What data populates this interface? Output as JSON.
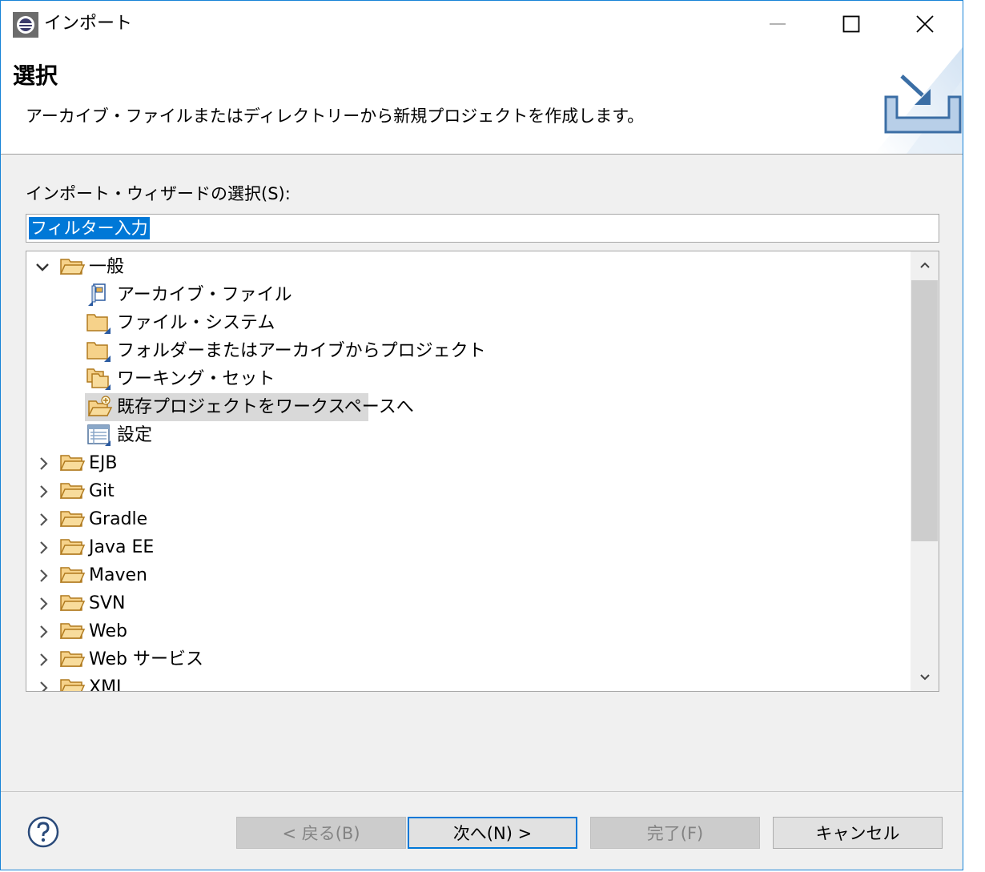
{
  "window": {
    "title": "インポート"
  },
  "banner": {
    "title": "選択",
    "description": "アーカイブ・ファイルまたはディレクトリーから新規プロジェクトを作成します。"
  },
  "wizard": {
    "label": "インポート・ウィザードの選択(S):",
    "filter_value": "フィルター入力"
  },
  "tree": {
    "items": [
      {
        "label": "一般",
        "expanded": true,
        "level": 0
      },
      {
        "label": "アーカイブ・ファイル",
        "level": 1,
        "icon": "archive-file-icon"
      },
      {
        "label": "ファイル・システム",
        "level": 1,
        "icon": "folder-icon"
      },
      {
        "label": "フォルダーまたはアーカイブからプロジェクト",
        "level": 1,
        "icon": "folder-icon"
      },
      {
        "label": "ワーキング・セット",
        "level": 1,
        "icon": "working-set-icon"
      },
      {
        "label": "既存プロジェクトをワークスペースへ",
        "level": 1,
        "icon": "existing-project-icon",
        "selected": true
      },
      {
        "label": "設定",
        "level": 1,
        "icon": "preferences-icon"
      },
      {
        "label": "EJB",
        "level": 0
      },
      {
        "label": "Git",
        "level": 0
      },
      {
        "label": "Gradle",
        "level": 0
      },
      {
        "label": "Java EE",
        "level": 0
      },
      {
        "label": "Maven",
        "level": 0
      },
      {
        "label": "SVN",
        "level": 0
      },
      {
        "label": "Web",
        "level": 0
      },
      {
        "label": "Web サービス",
        "level": 0
      },
      {
        "label": "XML",
        "level": 0
      }
    ]
  },
  "buttons": {
    "back": "< 戻る(B)",
    "next": "次へ(N) >",
    "finish": "完了(F)",
    "cancel": "キャンセル"
  },
  "colors": {
    "accent": "#0078d7",
    "window_border": "#1883d7",
    "folder": "#e8b04a"
  }
}
